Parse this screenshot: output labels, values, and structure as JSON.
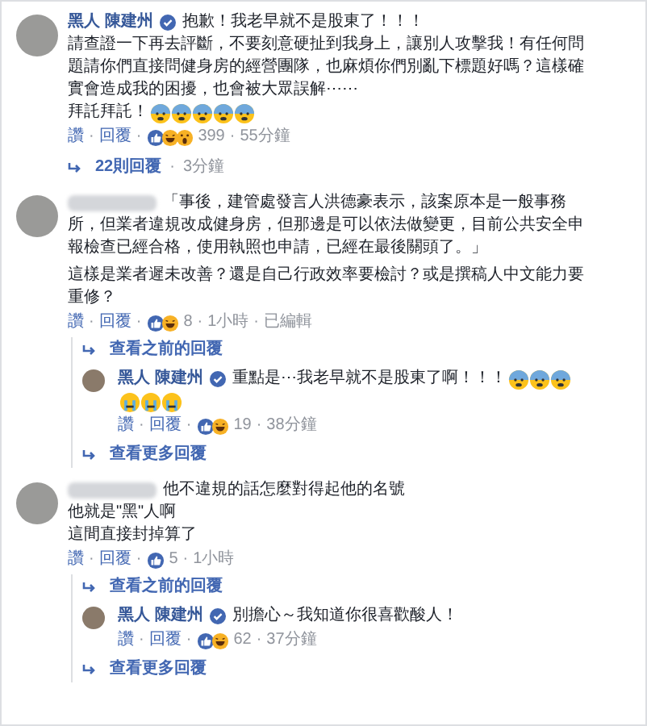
{
  "comments": [
    {
      "author": "黑人 陳建州",
      "verified": true,
      "author_blurred": false,
      "paragraphs": [
        [
          {
            "text": "抱歉！我老早就不是股東了！！！"
          },
          {
            "text": "請查證一下再去評斷，不要刻意硬扯到我身上，讓別人攻擊我！有任何問"
          },
          {
            "text": "題請你們直接問健身房的經營團隊，也麻煩你們別亂下標題好嗎？這樣確"
          },
          {
            "text": "實會造成我的困擾，也會被大眾誤解⋯⋯"
          },
          {
            "text": "拜託拜託！",
            "emoji": [
              {
                "kind": "fear"
              },
              {
                "kind": "fear"
              },
              {
                "kind": "fear"
              },
              {
                "kind": "fear"
              },
              {
                "kind": "fear"
              }
            ]
          }
        ]
      ],
      "actions": [
        {
          "kind": "link",
          "text": "讚"
        },
        {
          "kind": "sep",
          "text": "·"
        },
        {
          "kind": "link",
          "text": "回覆"
        },
        {
          "kind": "sep",
          "text": "·"
        },
        {
          "kind": "reactions",
          "reactions": [
            {
              "kind": "like"
            },
            {
              "kind": "haha"
            },
            {
              "kind": "wow"
            }
          ]
        },
        {
          "kind": "meta",
          "text": "399"
        },
        {
          "kind": "sep",
          "text": "·"
        },
        {
          "kind": "meta",
          "text": "55分鐘"
        }
      ],
      "thread": [
        {
          "kind": "link",
          "text": "22則回覆",
          "sep": "·",
          "time": "3分鐘"
        }
      ]
    },
    {
      "author_blurred": true,
      "verified": false,
      "paragraphs": [
        [
          {
            "text": "「事後，建管處發言人洪德豪表示，該案原本是一般事務"
          },
          {
            "text": "所，但業者違規改成健身房，但那邊是可以依法做變更，目前公共安全申"
          },
          {
            "text": "報檢查已經合格，使用執照也申請，已經在最後關頭了。」"
          }
        ],
        [
          {
            "text": "這樣是業者遲未改善？還是自己行政效率要檢討？或是撰稿人中文能力要"
          },
          {
            "text": "重修？"
          }
        ]
      ],
      "actions": [
        {
          "kind": "link",
          "text": "讚"
        },
        {
          "kind": "sep",
          "text": "·"
        },
        {
          "kind": "link",
          "text": "回覆"
        },
        {
          "kind": "sep",
          "text": "·"
        },
        {
          "kind": "reactions",
          "reactions": [
            {
              "kind": "like"
            },
            {
              "kind": "haha"
            }
          ]
        },
        {
          "kind": "meta",
          "text": "8"
        },
        {
          "kind": "sep",
          "text": "·"
        },
        {
          "kind": "meta",
          "text": "1小時"
        },
        {
          "kind": "sep",
          "text": "·"
        },
        {
          "kind": "meta",
          "text": "已編輯"
        }
      ],
      "thread": [
        {
          "kind": "link",
          "text": "查看之前的回覆"
        },
        {
          "kind": "comment",
          "author": "黑人 陳建州",
          "verified": true,
          "author_blurred": false,
          "paragraphs": [
            [
              {
                "text": "重點是⋯我老早就不是股東了啊！！！",
                "emoji": [
                  {
                    "kind": "fear"
                  },
                  {
                    "kind": "fear"
                  },
                  {
                    "kind": "fear"
                  }
                ]
              },
              {
                "emoji": [
                  {
                    "kind": "cry"
                  },
                  {
                    "kind": "cry"
                  },
                  {
                    "kind": "cry"
                  }
                ]
              }
            ]
          ],
          "actions": [
            {
              "kind": "link",
              "text": "讚"
            },
            {
              "kind": "sep",
              "text": "·"
            },
            {
              "kind": "link",
              "text": "回覆"
            },
            {
              "kind": "sep",
              "text": "·"
            },
            {
              "kind": "reactions",
              "reactions": [
                {
                  "kind": "like"
                },
                {
                  "kind": "haha"
                }
              ]
            },
            {
              "kind": "meta",
              "text": "19"
            },
            {
              "kind": "sep",
              "text": "·"
            },
            {
              "kind": "meta",
              "text": "38分鐘"
            }
          ]
        },
        {
          "kind": "link",
          "text": "查看更多回覆"
        }
      ]
    },
    {
      "author_blurred": true,
      "verified": false,
      "paragraphs": [
        [
          {
            "text": "他不違規的話怎麼對得起他的名號"
          },
          {
            "text": "他就是\"黑\"人啊"
          },
          {
            "text": "這間直接封掉算了"
          }
        ]
      ],
      "actions": [
        {
          "kind": "link",
          "text": "讚"
        },
        {
          "kind": "sep",
          "text": "·"
        },
        {
          "kind": "link",
          "text": "回覆"
        },
        {
          "kind": "sep",
          "text": "·"
        },
        {
          "kind": "reactions",
          "reactions": [
            {
              "kind": "like"
            }
          ]
        },
        {
          "kind": "meta",
          "text": "5"
        },
        {
          "kind": "sep",
          "text": "·"
        },
        {
          "kind": "meta",
          "text": "1小時"
        }
      ],
      "thread": [
        {
          "kind": "link",
          "text": "查看之前的回覆"
        },
        {
          "kind": "comment",
          "author": "黑人 陳建州",
          "verified": true,
          "author_blurred": false,
          "paragraphs": [
            [
              {
                "text": "別擔心～我知道你很喜歡酸人！"
              }
            ]
          ],
          "actions": [
            {
              "kind": "link",
              "text": "讚"
            },
            {
              "kind": "sep",
              "text": "·"
            },
            {
              "kind": "link",
              "text": "回覆"
            },
            {
              "kind": "sep",
              "text": "·"
            },
            {
              "kind": "reactions",
              "reactions": [
                {
                  "kind": "like"
                },
                {
                  "kind": "haha"
                }
              ]
            },
            {
              "kind": "meta",
              "text": "62"
            },
            {
              "kind": "sep",
              "text": "·"
            },
            {
              "kind": "meta",
              "text": "37分鐘"
            }
          ]
        },
        {
          "kind": "link",
          "text": "查看更多回覆"
        }
      ]
    }
  ]
}
